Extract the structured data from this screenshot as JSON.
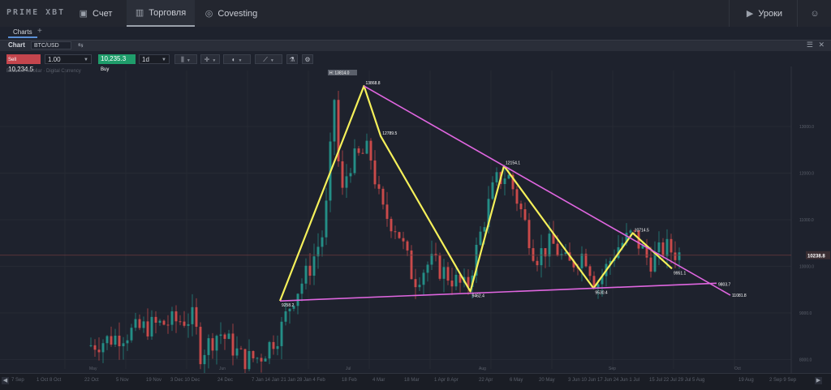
{
  "nav": {
    "logo": "PRIME XBT",
    "items": [
      {
        "label": "Счет",
        "icon": "wallet-icon"
      },
      {
        "label": "Торговля",
        "icon": "bar-chart-icon"
      },
      {
        "label": "Covesting",
        "icon": "covesting-icon"
      }
    ],
    "lessons_label": "Уроки",
    "active_index": 1
  },
  "tabs": {
    "items": [
      "Charts"
    ],
    "add": "+"
  },
  "chart_header": {
    "label": "Chart",
    "symbol": "BTC/USD"
  },
  "toolbar": {
    "sell_label": "Sell",
    "sell_price": "10,234.5",
    "quantity": "1.00",
    "buy_price": "10,235.3",
    "buy_label": "Buy",
    "timeframe": "1d"
  },
  "chart_subtitle": "Bitcoin/USDollar · Digital Currency",
  "chart_data": {
    "type": "candlestick",
    "current_price": "10238.8",
    "price_axis_labels": [
      "13000.0",
      "12000.0",
      "11000.0",
      "10000.0",
      "9000.0",
      "8000.0"
    ],
    "high_label": "H: 13814.0",
    "zigzag_points": [
      {
        "index": 0,
        "price": 9258.2,
        "label": "9258.2"
      },
      {
        "index": 15,
        "price": 13868.8,
        "label": "13868.8"
      },
      {
        "index": 18,
        "price": 12789.5,
        "label": "12789.5"
      },
      {
        "index": 34,
        "price": 9462.4,
        "label": "9462.4"
      },
      {
        "index": 40,
        "price": 12154.1,
        "label": "12154.1"
      },
      {
        "index": 56,
        "price": 9530.4,
        "label": "9530.4"
      },
      {
        "index": 63,
        "price": 10714.5,
        "label": "10714.5"
      },
      {
        "index": 70,
        "price": 9951.1,
        "label": "9951.1"
      }
    ],
    "trendline_upper_end": "11081.8",
    "trendline_lower_end": "9803.7",
    "time_labels": [
      "7 Sep",
      "1 Oct 8 Oct",
      "22 Oct",
      "5 Nov",
      "19 Nov",
      "3 Dec 10 Dec",
      "24 Dec",
      "7 Jan 14 Jan 21 Jan 28 Jan 4 Feb",
      "18 Feb",
      "4 Mar",
      "18 Mar",
      "1 Apr 8 Apr",
      "22 Apr",
      "6 May",
      "20 May",
      "3 Jun 10 Jun 17 Jun 24 Jun 1 Jul",
      "15 Jul 22 Jul 29 Jul 5 Aug",
      "19 Aug",
      "2 Sep 9 Sep"
    ],
    "month_labels": [
      "May",
      "Jun",
      "Jul",
      "Aug",
      "Sep",
      "Oct"
    ]
  },
  "colors": {
    "background": "#1e222d",
    "up_candle": "#26a69a",
    "down_candle": "#ef5350",
    "zigzag": "#f5f05a",
    "trendline": "#e066e0",
    "sell": "#c4454d",
    "buy": "#1f9d6b"
  }
}
